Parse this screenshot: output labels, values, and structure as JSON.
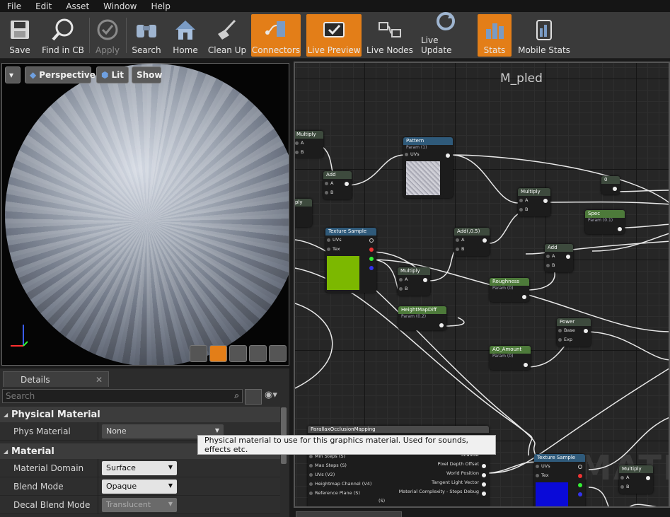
{
  "menu": [
    "File",
    "Edit",
    "Asset",
    "Window",
    "Help"
  ],
  "toolbar": {
    "buttons": [
      {
        "label": "Save",
        "icon": "save-icon"
      },
      {
        "label": "Find in CB",
        "icon": "find-in-cb-icon"
      },
      {
        "label": "Apply",
        "icon": "apply-icon"
      },
      {
        "label": "Search",
        "icon": "search-icon"
      },
      {
        "label": "Home",
        "icon": "home-icon"
      },
      {
        "label": "Clean Up",
        "icon": "clean-up-icon"
      },
      {
        "label": "Connectors",
        "icon": "connectors-icon"
      },
      {
        "label": "Live Preview",
        "icon": "live-preview-icon"
      },
      {
        "label": "Live Nodes",
        "icon": "live-nodes-icon"
      },
      {
        "label": "Live Update",
        "icon": "live-update-icon"
      },
      {
        "label": "Stats",
        "icon": "stats-icon"
      },
      {
        "label": "Mobile Stats",
        "icon": "mobile-stats-icon"
      }
    ]
  },
  "viewport": {
    "perspective_label": "Perspective",
    "lit_label": "Lit",
    "show_label": "Show"
  },
  "details": {
    "tab_label": "Details",
    "search_placeholder": "Search",
    "physical_material_category": "Physical Material",
    "phys_material_label": "Phys Material",
    "phys_material_value": "None",
    "material_category": "Material",
    "material_domain_label": "Material Domain",
    "material_domain_value": "Surface",
    "blend_mode_label": "Blend Mode",
    "blend_mode_value": "Opaque",
    "decal_blend_mode_label": "Decal Blend Mode",
    "decal_blend_mode_value": "Translucent"
  },
  "graph": {
    "title": "M_pled",
    "watermark": "MATE",
    "nodes": {
      "multiply1": "Multiply",
      "add1": "Add",
      "pattern": "Pattern",
      "pattern_sub": "Param (1)",
      "texture_sample1": "Texture Sample",
      "add2": "Add(,0.5)",
      "multiply2": "Multiply",
      "multiply3": "Multiply",
      "heightmapdiff": "HeightMapDiff",
      "heightmapdiff_sub": "Param (0.2)",
      "zero": "0",
      "spec": "Spec",
      "spec_sub": "Param (0.1)",
      "add3": "Add",
      "roughness": "Roughness",
      "roughness_sub": "Param (0)",
      "power": "Power",
      "ao_amount": "AO_Amount",
      "ao_amount_sub": "Param (0)",
      "pom": "ParallaxOcclusionMapping",
      "texture_sample2": "Texture Sample",
      "multiply4": "Multiply",
      "multiply_left": "ply"
    },
    "pins": {
      "a": "A",
      "b": "B",
      "uvs": "UVs",
      "tex": "Tex",
      "base": "Base",
      "exp": "Exp",
      "max_steps": "Max Steps (S)",
      "uvs_v2": "UVs (V2)",
      "heightmap_channel": "Heightmap Channel (V4)",
      "reference_plane": "Reference Plane (S)",
      "pixel_depth_offset": "Pixel Depth Offset",
      "world_position": "World Position",
      "tangent_light_vector": "Tangent Light Vector",
      "material_complexity": "Material Complexity - Steps Debug",
      "min_steps": "Min Steps (S)",
      "shadow": "Shadow",
      "extra": "(S)"
    }
  },
  "tooltip": "Physical material to use for this graphics material. Used for sounds, effects etc.",
  "colors": {
    "accent": "#e37e18",
    "texture_green": "#7cb800",
    "texture_blue": "#0a0ad8"
  }
}
